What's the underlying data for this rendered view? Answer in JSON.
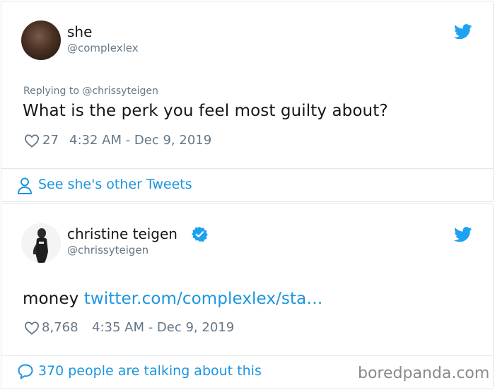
{
  "tweet1": {
    "author_name": "she",
    "author_handle": "@complexlex",
    "reply_context": "Replying to @chrissyteigen",
    "text": "What is the perk you feel most guilty about?",
    "likes": "27",
    "timestamp": "4:32 AM - Dec 9, 2019",
    "footer_action": "See she's other Tweets"
  },
  "tweet2": {
    "author_name": "christine teigen",
    "author_handle": "@chrissyteigen",
    "text_prefix": "money ",
    "text_link": "twitter.com/complexlex/sta…",
    "likes": "8,768",
    "timestamp": "4:35 AM - Dec 9, 2019",
    "footer_action": "370 people are talking about this"
  },
  "watermark": "boredpanda.com",
  "colors": {
    "twitter_blue": "#1da1f2",
    "link_blue": "#1b95e0",
    "muted_gray": "#657786",
    "border": "#e1e8ed"
  },
  "icons": [
    "twitter-bird-icon",
    "heart-icon",
    "person-icon",
    "verified-badge-icon",
    "speech-bubble-icon"
  ]
}
